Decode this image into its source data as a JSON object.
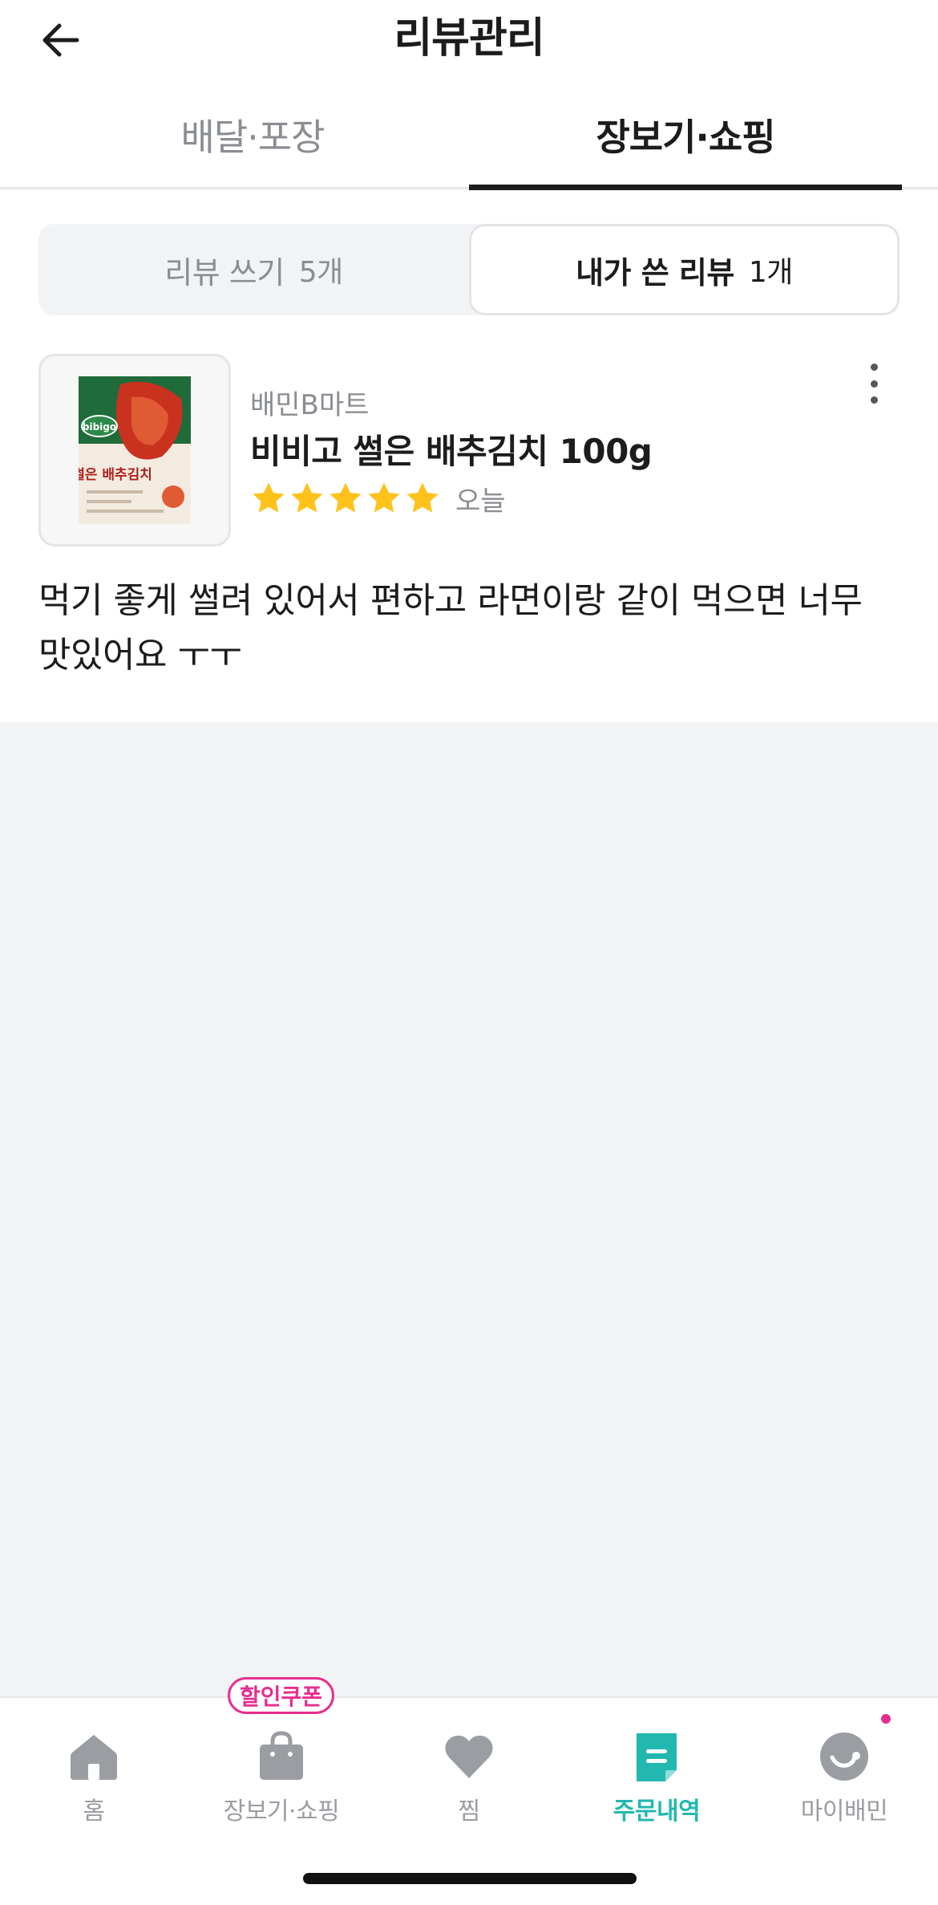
{
  "header": {
    "title": "리뷰관리"
  },
  "top_tabs": [
    {
      "label": "배달·포장",
      "active": false
    },
    {
      "label": "장보기·쇼핑",
      "active": true
    }
  ],
  "segments": [
    {
      "label": "리뷰 쓰기",
      "count": "5개",
      "active": false
    },
    {
      "label": "내가 쓴 리뷰",
      "count": "1개",
      "active": true
    }
  ],
  "review": {
    "store": "배민B마트",
    "product": "비비고 썰은 배추김치 100g",
    "rating": 5,
    "date": "오늘",
    "text": "먹기 좋게 썰려 있어서 편하고 라면이랑 같이 먹으면 너무 맛있어요 ㅜㅜ",
    "thumbnail": {
      "brand": "bibigo",
      "name": "썰은 배추김치"
    }
  },
  "bottom_nav": {
    "coupon_badge": "할인쿠폰",
    "items": [
      {
        "label": "홈",
        "icon": "home-icon",
        "active": false
      },
      {
        "label": "장보기·쇼핑",
        "icon": "shopping-bag-icon",
        "active": false
      },
      {
        "label": "찜",
        "icon": "heart-icon",
        "active": false
      },
      {
        "label": "주문내역",
        "icon": "order-list-icon",
        "active": true
      },
      {
        "label": "마이배민",
        "icon": "my-profile-icon",
        "active": false
      }
    ]
  },
  "colors": {
    "accent": "#22b8b0",
    "star": "#ffc21a",
    "badge": "#e62e8f",
    "inactive": "#9a9da2"
  }
}
